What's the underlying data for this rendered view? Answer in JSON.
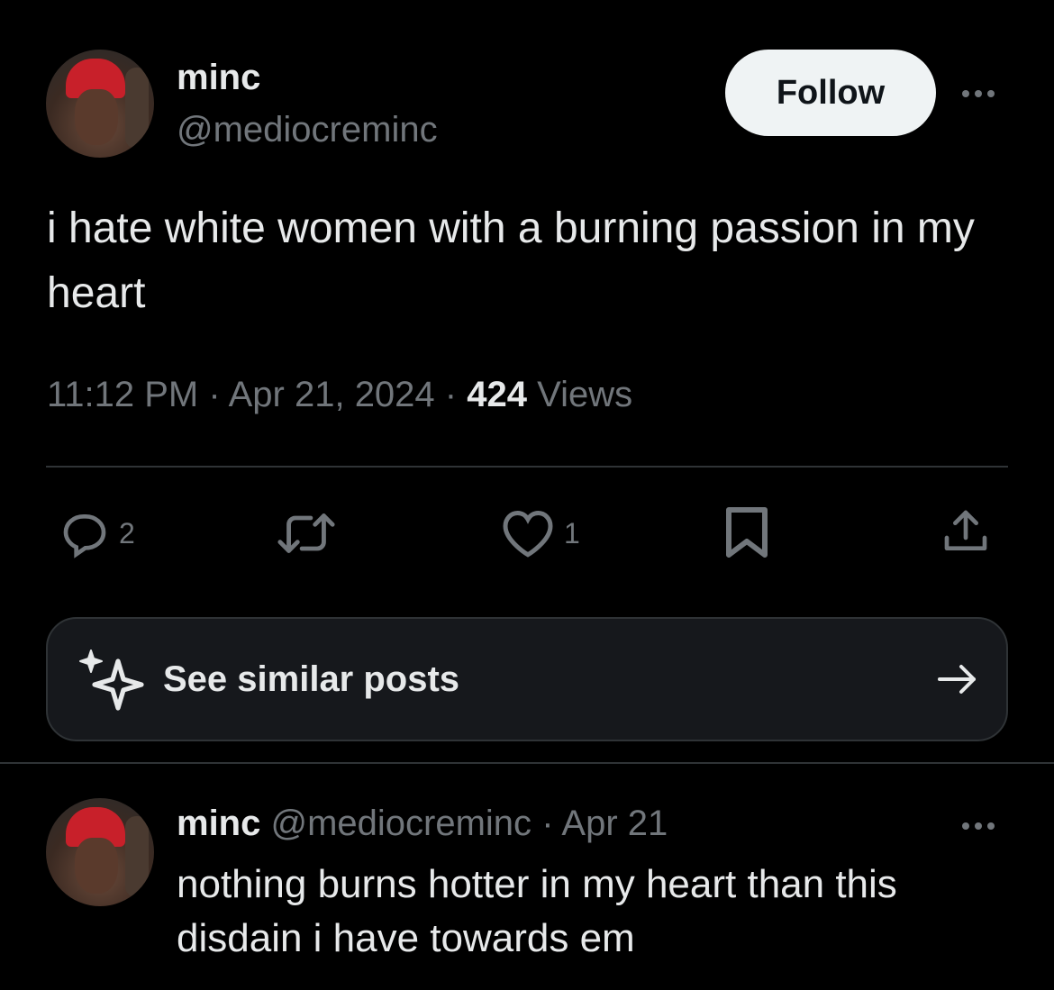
{
  "tweet": {
    "author": {
      "name": "minc",
      "handle": "@mediocreminc"
    },
    "follow_label": "Follow",
    "text": "i hate white women with a burning passion in my heart",
    "time": "11:12 PM",
    "date": "Apr 21, 2024",
    "separator": "·",
    "views_count": "424",
    "views_label": "Views",
    "actions": {
      "reply_count": "2",
      "like_count": "1"
    }
  },
  "similar_posts": {
    "label": "See similar posts"
  },
  "reply": {
    "author": {
      "name": "minc",
      "handle": "@mediocreminc"
    },
    "date": "Apr 21",
    "separator": "·",
    "text": "nothing burns hotter in my heart than this disdain i have towards em"
  },
  "icons": [
    "more-icon",
    "reply-icon",
    "retweet-icon",
    "like-icon",
    "bookmark-icon",
    "share-icon",
    "sparkle-icon",
    "arrow-right-icon"
  ],
  "colors": {
    "background": "#000000",
    "text": "#e7e9ea",
    "secondary": "#71767b",
    "divider": "#2f3336",
    "follow_button_bg": "#eff3f4"
  }
}
